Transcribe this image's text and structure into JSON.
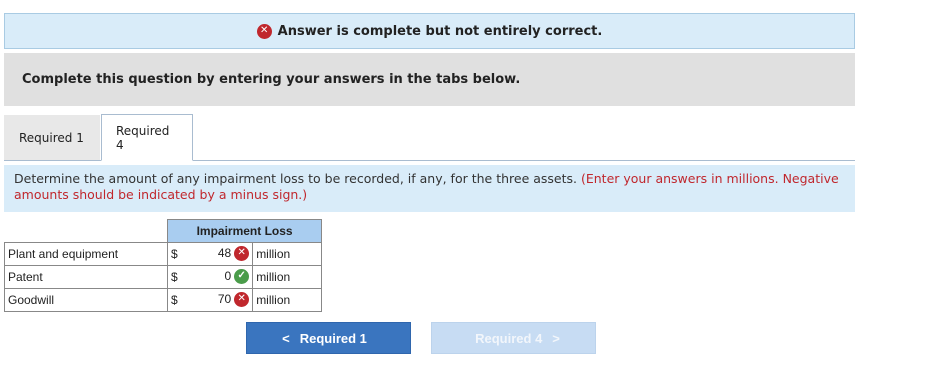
{
  "banner": {
    "text": "Answer is complete but not entirely correct.",
    "status_icon": "x-circle-icon",
    "status_color": "#c0272d"
  },
  "instruction": {
    "text": "Complete this question by entering your answers in the tabs below."
  },
  "tabs": [
    {
      "label": "Required 1",
      "active": false
    },
    {
      "label": "Required 4",
      "active": true
    }
  ],
  "question": {
    "text": "Determine the amount of any impairment loss to be recorded, if any, for the three assets.",
    "note": "(Enter your answers in millions. Negative amounts should be indicated by a minus sign.)"
  },
  "table": {
    "header": "Impairment Loss",
    "currency": "$",
    "unit": "million",
    "rows": [
      {
        "label": "Plant and equipment",
        "value": "48",
        "status": "incorrect"
      },
      {
        "label": "Patent",
        "value": "0",
        "status": "correct"
      },
      {
        "label": "Goodwill",
        "value": "70",
        "status": "incorrect"
      }
    ]
  },
  "nav": {
    "prev_label": "Required 1",
    "next_label": "Required 4",
    "prev_chevron": "<",
    "next_chevron": ">"
  },
  "colors": {
    "accent": "#3a75bf",
    "incorrect": "#c0272d",
    "correct": "#4a9c4a",
    "banner_bg": "#d9ecf9"
  }
}
